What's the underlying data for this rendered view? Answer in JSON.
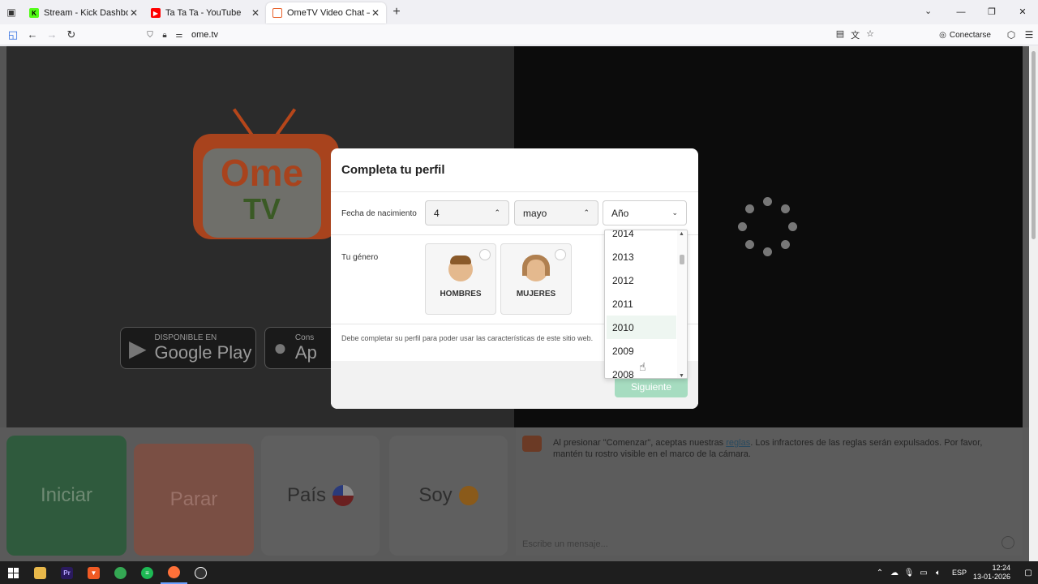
{
  "browser": {
    "tabs": [
      {
        "title": "Stream - Kick Dashboard",
        "favicon_color": "#53fc18",
        "favicon_text": "K",
        "active": false
      },
      {
        "title": "Ta Ta Ta - YouTube",
        "favicon_color": "#ff0000",
        "favicon_text": "▶",
        "active": false
      },
      {
        "title": "OmeTV Video Chat — Omegle",
        "favicon_color": "#e8622c",
        "favicon_text": "",
        "active": true
      }
    ],
    "url": "ome.tv",
    "connect_label": "Conectarse"
  },
  "page": {
    "store_google_small": "DISPONIBLE EN",
    "store_google_big": "Google Play",
    "store_apple_small": "Cons",
    "store_apple_big": "Ap",
    "logo_top": "Ome",
    "logo_bottom": "TV",
    "buttons": {
      "start": "Iniciar",
      "stop": "Parar",
      "country": "País",
      "me": "Soy"
    },
    "chat": {
      "rules_before": "Al presionar \"Comenzar\", aceptas nuestras ",
      "rules_link": "reglas",
      "rules_after": ". Los infractores de las reglas serán expulsados. Por favor, mantén tu rostro visible en el marco de la cámara.",
      "message_placeholder": "Escribe un mensaje..."
    }
  },
  "modal": {
    "title": "Completa tu perfil",
    "birth_label": "Fecha de nacimiento",
    "day_value": "4",
    "month_value": "mayo",
    "year_placeholder": "Año",
    "gender_label": "Tu género",
    "gender_options": [
      {
        "label": "HOMBRES",
        "avatar_color": "#c98f5a"
      },
      {
        "label": "MUJERES",
        "avatar_color": "#c98f5a"
      }
    ],
    "note": "Debe completar su perfil para poder usar las características de este sitio web.",
    "next_button": "Siguiente",
    "year_options": [
      "2014",
      "2013",
      "2012",
      "2011",
      "2010",
      "2009",
      "2008"
    ],
    "hovered_year": "2010"
  },
  "taskbar": {
    "lang": "ESP",
    "time": "12:24",
    "date": "13-01-2026"
  },
  "colors": {
    "accent_green": "#a6dcc0",
    "brand_orange": "#e8622c"
  }
}
